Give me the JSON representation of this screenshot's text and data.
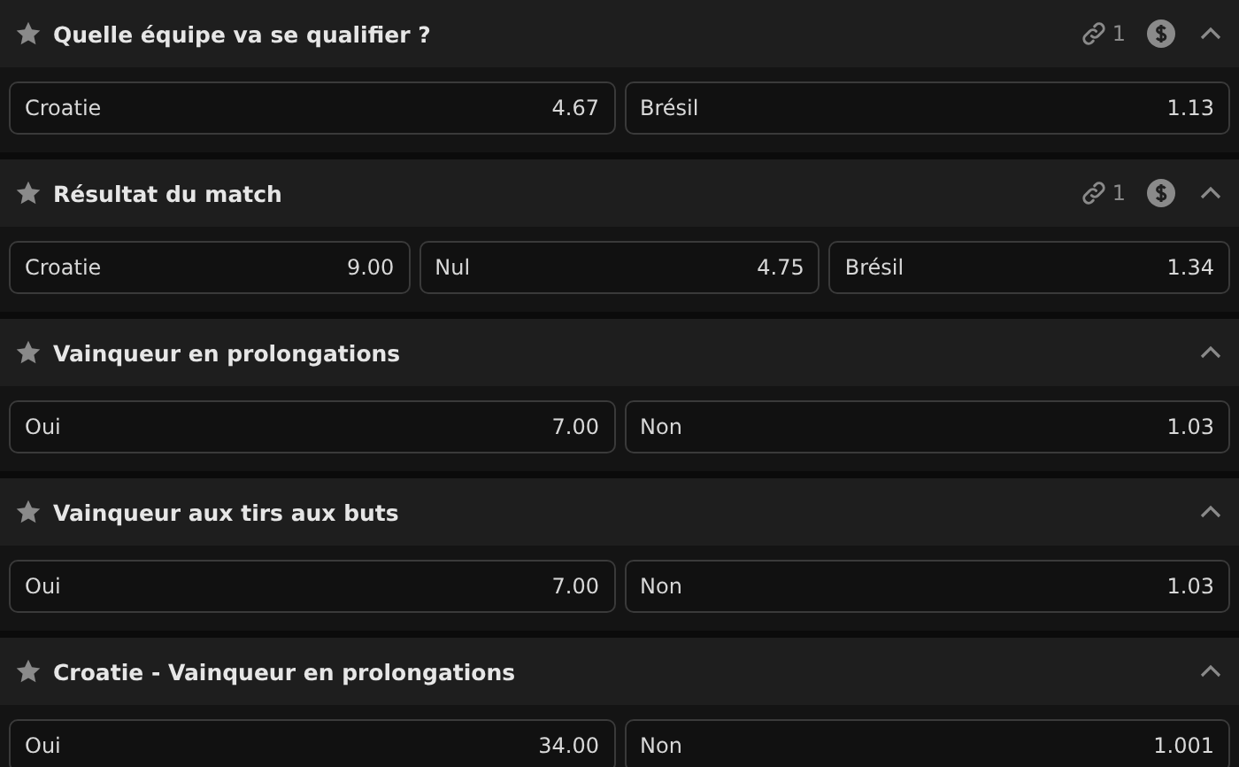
{
  "markets": [
    {
      "title": "Quelle équipe va se qualifier ?",
      "favorite": false,
      "links": "1",
      "cashout": true,
      "expanded": true,
      "odds": [
        {
          "label": "Croatie",
          "value": "4.67"
        },
        {
          "label": "Brésil",
          "value": "1.13"
        }
      ]
    },
    {
      "title": "Résultat du match",
      "favorite": false,
      "links": "1",
      "cashout": true,
      "expanded": true,
      "odds": [
        {
          "label": "Croatie",
          "value": "9.00"
        },
        {
          "label": "Nul",
          "value": "4.75"
        },
        {
          "label": "Brésil",
          "value": "1.34"
        }
      ]
    },
    {
      "title": "Vainqueur en prolongations",
      "favorite": false,
      "cashout": false,
      "expanded": true,
      "odds": [
        {
          "label": "Oui",
          "value": "7.00"
        },
        {
          "label": "Non",
          "value": "1.03"
        }
      ]
    },
    {
      "title": "Vainqueur aux tirs aux buts",
      "favorite": false,
      "cashout": false,
      "expanded": true,
      "odds": [
        {
          "label": "Oui",
          "value": "7.00"
        },
        {
          "label": "Non",
          "value": "1.03"
        }
      ]
    },
    {
      "title": "Croatie - Vainqueur en prolongations",
      "favorite": false,
      "cashout": false,
      "expanded": true,
      "odds": [
        {
          "label": "Oui",
          "value": "34.00"
        },
        {
          "label": "Non",
          "value": "1.001"
        }
      ]
    }
  ]
}
